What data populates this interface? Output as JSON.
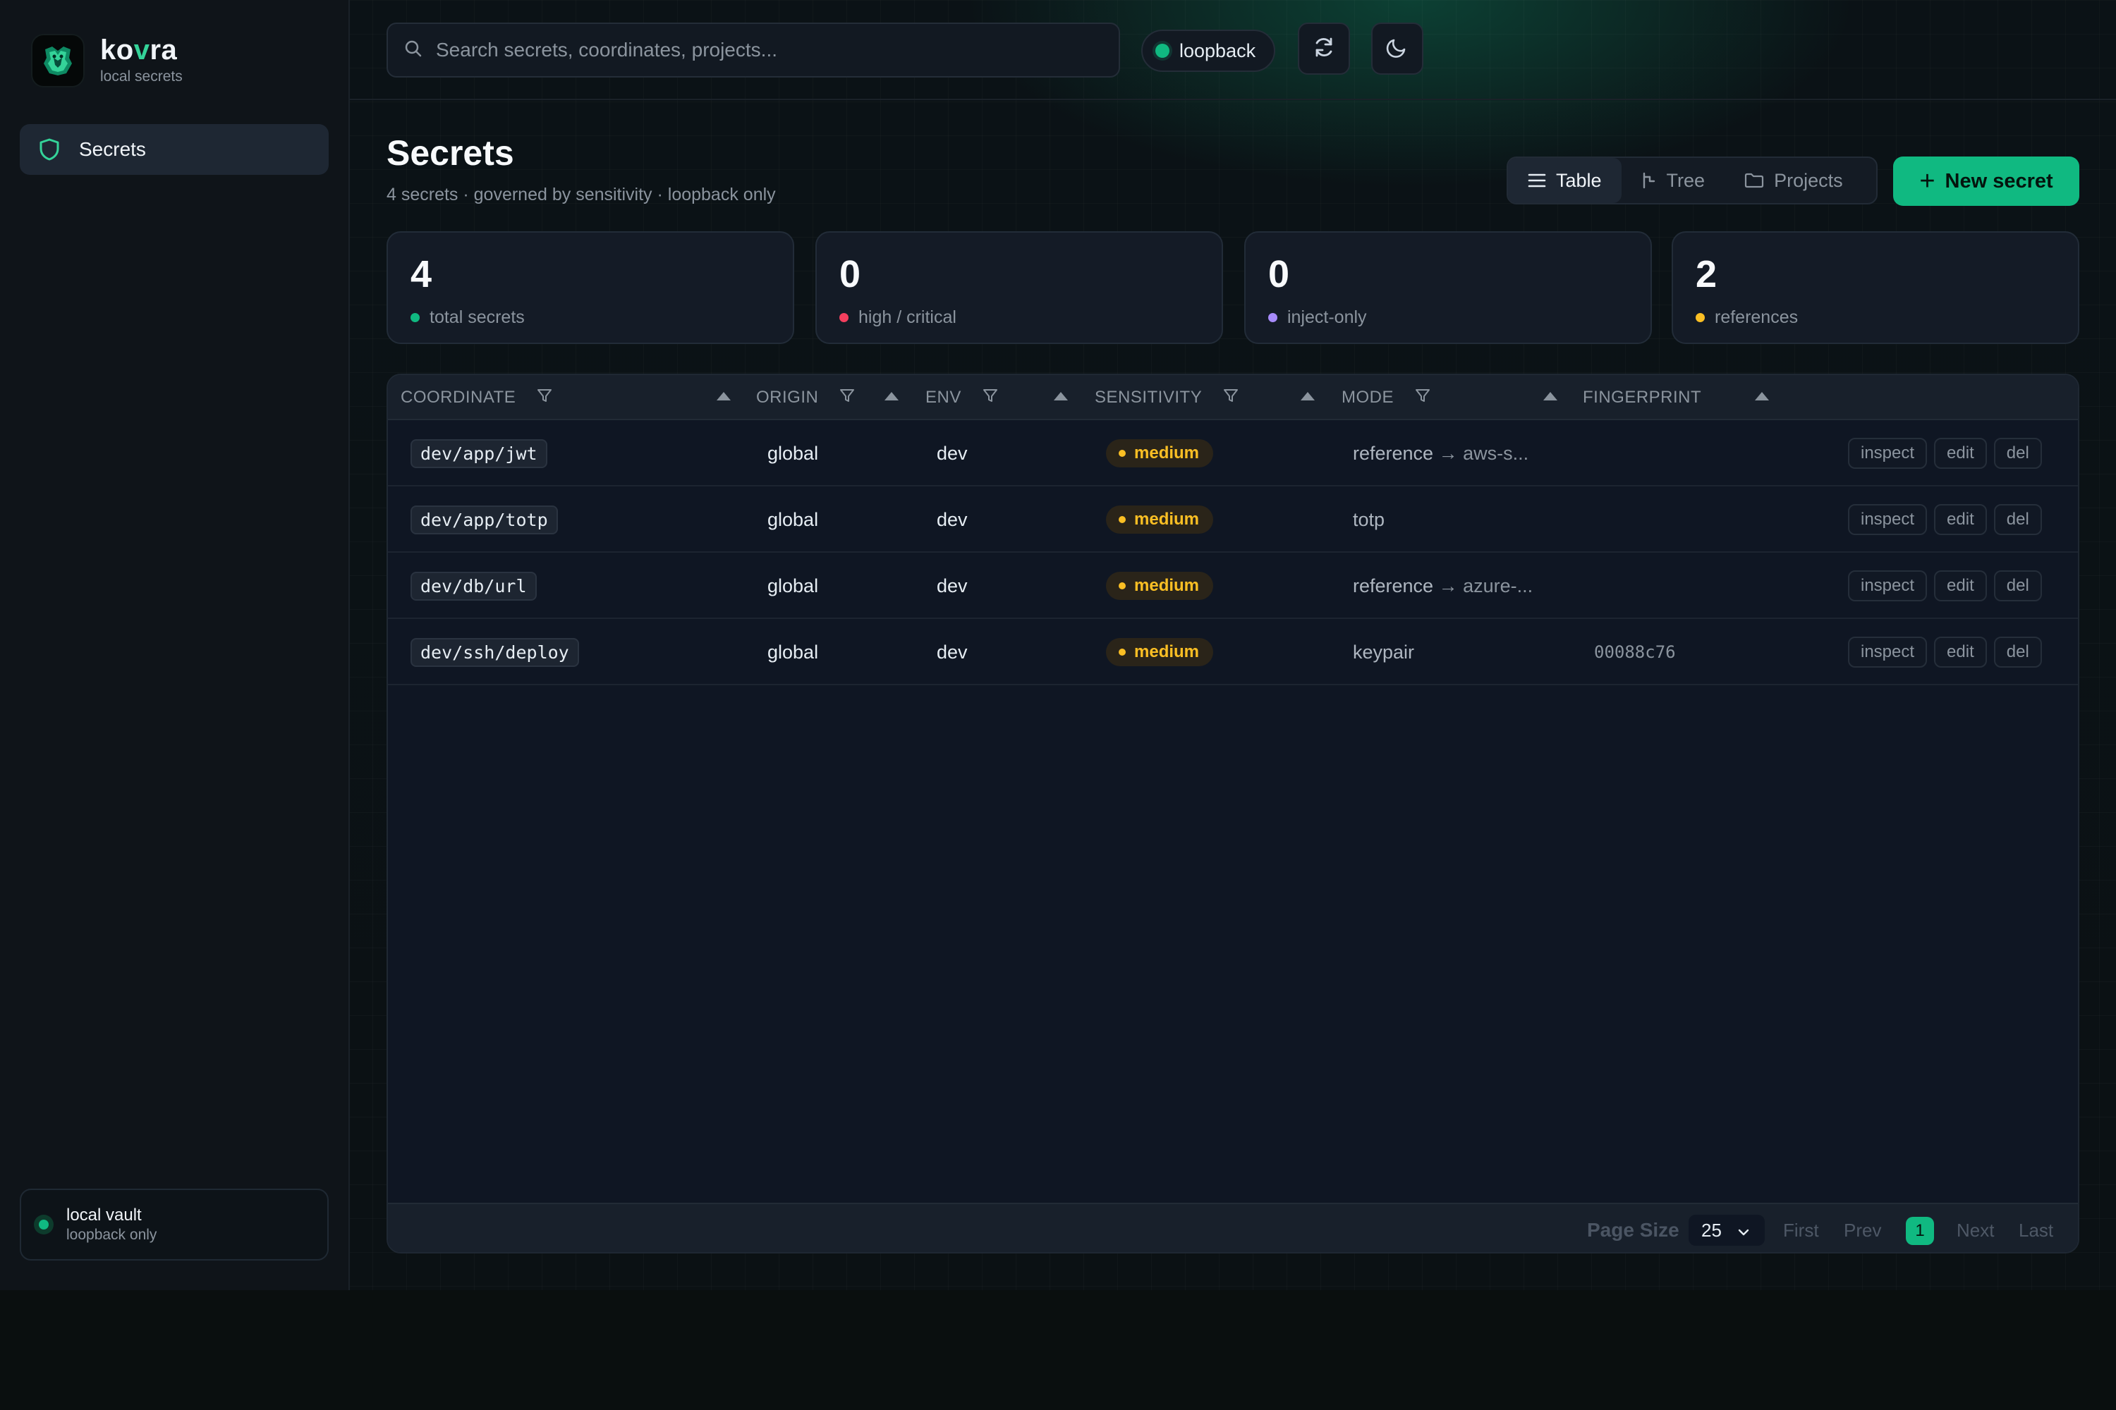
{
  "sidebar": {
    "brand_name_prefix": "ko",
    "brand_name_accent": "v",
    "brand_name_suffix": "ra",
    "brand_subtitle": "local secrets",
    "nav": [
      {
        "label": "Secrets",
        "icon": "shield-icon",
        "active": true
      }
    ],
    "vault": {
      "title": "local vault",
      "subtitle": "loopback only",
      "status_color": "#10b981"
    }
  },
  "topbar": {
    "search_placeholder": "Search secrets, coordinates, projects...",
    "connection_label": "loopback",
    "connection_color": "#10b981",
    "refresh_icon": "refresh-icon",
    "theme_icon": "moon-icon"
  },
  "header": {
    "title": "Secrets",
    "subtitle": "4 secrets · governed by sensitivity · loopback only",
    "views": [
      {
        "label": "Table",
        "icon": "list-icon",
        "active": true
      },
      {
        "label": "Tree",
        "icon": "tree-icon",
        "active": false
      },
      {
        "label": "Projects",
        "icon": "folder-icon",
        "active": false
      }
    ],
    "new_button": "New secret"
  },
  "stats": [
    {
      "value": "4",
      "label": "total secrets",
      "color": "#10b981"
    },
    {
      "value": "0",
      "label": "high / critical",
      "color": "#f43f5e"
    },
    {
      "value": "0",
      "label": "inject-only",
      "color": "#a78bfa"
    },
    {
      "value": "2",
      "label": "references",
      "color": "#fbbf24"
    }
  ],
  "table": {
    "columns": [
      "COORDINATE",
      "ORIGIN",
      "ENV",
      "SENSITIVITY",
      "MODE",
      "FINGERPRINT"
    ],
    "rows": [
      {
        "coordinate": "dev/app/jwt",
        "origin": "global",
        "env": "dev",
        "sensitivity": "medium",
        "mode": "reference",
        "mode_target": "→ aws-s...",
        "fingerprint": ""
      },
      {
        "coordinate": "dev/app/totp",
        "origin": "global",
        "env": "dev",
        "sensitivity": "medium",
        "mode": "totp",
        "mode_target": "",
        "fingerprint": ""
      },
      {
        "coordinate": "dev/db/url",
        "origin": "global",
        "env": "dev",
        "sensitivity": "medium",
        "mode": "reference",
        "mode_target": "→ azure-...",
        "fingerprint": ""
      },
      {
        "coordinate": "dev/ssh/deploy",
        "origin": "global",
        "env": "dev",
        "sensitivity": "medium",
        "mode": "keypair",
        "mode_target": "",
        "fingerprint": "00088c76"
      }
    ],
    "actions": [
      "inspect",
      "edit",
      "del"
    ],
    "sensitivity_color": "#fbbf24"
  },
  "pagination": {
    "page_size_label": "Page Size",
    "page_size": "25",
    "first": "First",
    "prev": "Prev",
    "current": "1",
    "next": "Next",
    "last": "Last"
  }
}
